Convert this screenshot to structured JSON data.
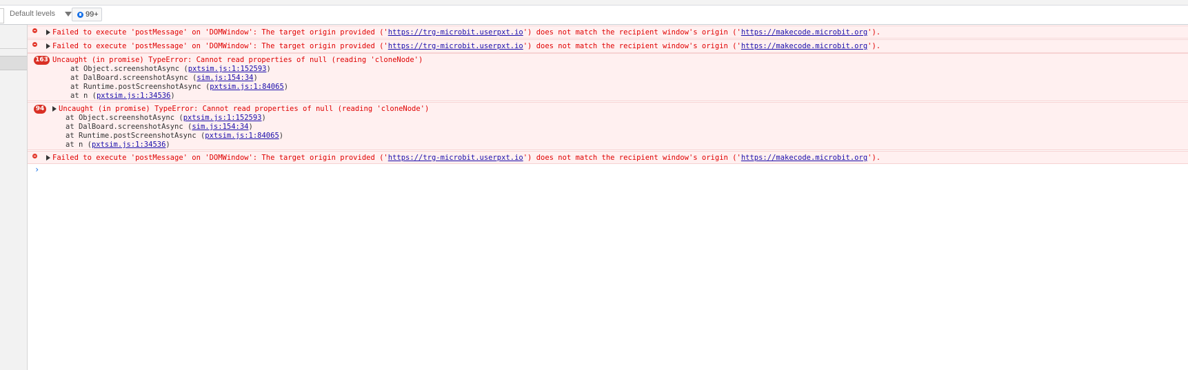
{
  "toolbar": {
    "levels_label": "Default levels",
    "issues_count": "99+"
  },
  "messages": [
    {
      "pre": "Failed to execute 'postMessage' on 'DOMWindow': The target origin provided ('",
      "link1": "https://trg-microbit.userpxt.io",
      "mid": "') does not match the recipient window's origin ('",
      "link2": "https://makecode.microbit.org",
      "post": "')."
    },
    {
      "pre": "Failed to execute 'postMessage' on 'DOMWindow': The target origin provided ('",
      "link1": "https://trg-microbit.userpxt.io",
      "mid": "') does not match the recipient window's origin ('",
      "link2": "https://makecode.microbit.org",
      "post": "')."
    },
    {
      "count": "163",
      "text": "Uncaught (in promise) TypeError: Cannot read properties of null (reading 'cloneNode')",
      "stack": [
        {
          "pre": "at Object.screenshotAsync (",
          "link": "pxtsim.js:1:152593",
          "post": ")"
        },
        {
          "pre": "at DalBoard.screenshotAsync (",
          "link": "sim.js:154:34",
          "post": ")"
        },
        {
          "pre": "at Runtime.postScreenshotAsync (",
          "link": "pxtsim.js:1:84065",
          "post": ")"
        },
        {
          "pre": "at n (",
          "link": "pxtsim.js:1:34536",
          "post": ")"
        }
      ]
    },
    {
      "count": "94",
      "text": "Uncaught (in promise) TypeError: Cannot read properties of null (reading 'cloneNode')",
      "stack": [
        {
          "pre": "at Object.screenshotAsync (",
          "link": "pxtsim.js:1:152593",
          "post": ")"
        },
        {
          "pre": "at DalBoard.screenshotAsync (",
          "link": "sim.js:154:34",
          "post": ")"
        },
        {
          "pre": "at Runtime.postScreenshotAsync (",
          "link": "pxtsim.js:1:84065",
          "post": ")"
        },
        {
          "pre": "at n (",
          "link": "pxtsim.js:1:34536",
          "post": ")"
        }
      ]
    },
    {
      "pre": "Failed to execute 'postMessage' on 'DOMWindow': The target origin provided ('",
      "link1": "https://trg-microbit.userpxt.io",
      "mid": "') does not match the recipient window's origin ('",
      "link2": "https://makecode.microbit.org",
      "post": "')."
    }
  ],
  "prompt_symbol": "›",
  "colors": {
    "error_text": "#e00000",
    "error_bg": "#fff0f0",
    "link": "#1a0dab",
    "badge": "#d93025",
    "accent": "#1a73e8"
  }
}
